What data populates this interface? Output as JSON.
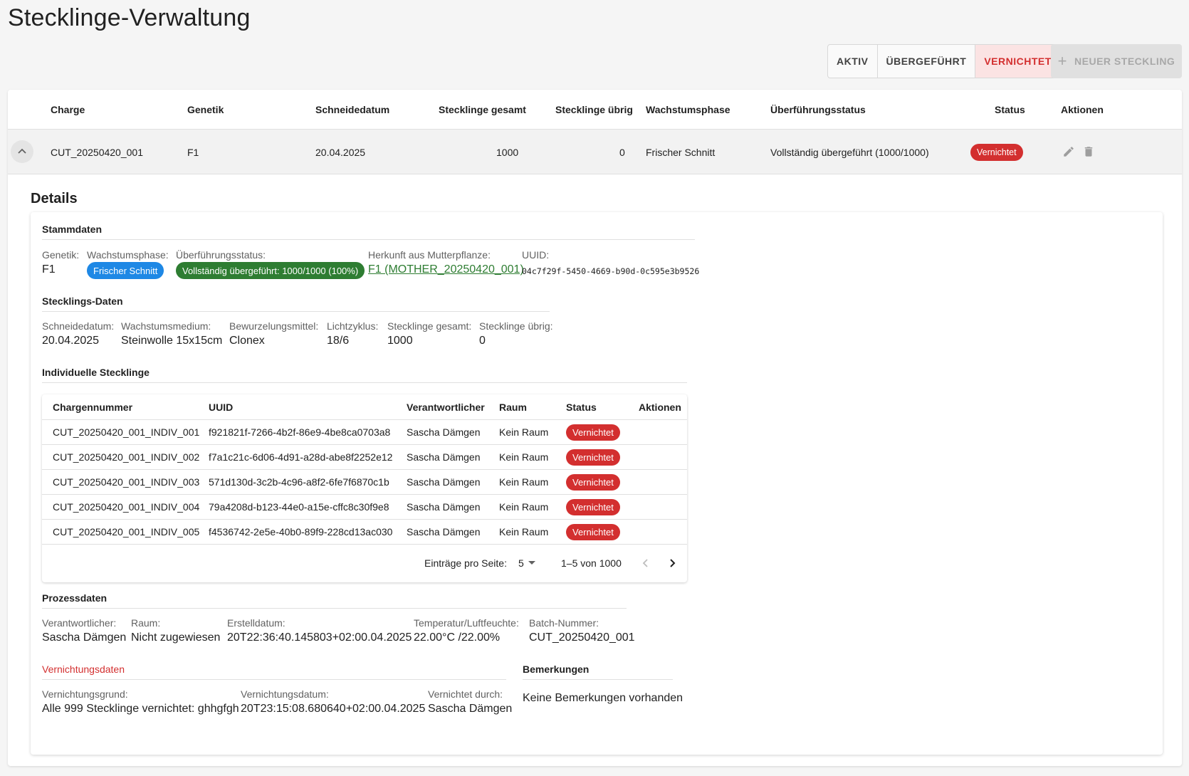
{
  "page": {
    "title": "Stecklinge-Verwaltung"
  },
  "filters": [
    {
      "label": "AKTIV",
      "active": false
    },
    {
      "label": "ÜBERGEFÜHRT",
      "active": false
    },
    {
      "label": "VERNICHTET",
      "active": true
    }
  ],
  "new_button": {
    "label": "NEUER STECKLING",
    "disabled": true
  },
  "table": {
    "headers": [
      "Charge",
      "Genetik",
      "Schneidedatum",
      "Stecklinge gesamt",
      "Stecklinge übrig",
      "Wachstumsphase",
      "Überführungsstatus",
      "Status",
      "Aktionen"
    ],
    "row": {
      "charge": "CUT_20250420_001",
      "genetik": "F1",
      "schneidedatum": "20.04.2025",
      "gesamt": "1000",
      "uebrig": "0",
      "phase": "Frischer Schnitt",
      "ueberfuehrung": "Vollständig übergeführt (1000/1000)",
      "status": "Vernichtet"
    }
  },
  "details": {
    "title": "Details",
    "stammdaten": {
      "title": "Stammdaten",
      "genetik_label": "Genetik:",
      "genetik": "F1",
      "phase_label": "Wachstumsphase:",
      "phase": "Frischer Schnitt",
      "ueber_label": "Überführungsstatus:",
      "ueber": "Vollständig übergeführt: 1000/1000 (100%)",
      "herkunft_label": "Herkunft aus Mutterpflanze:",
      "herkunft": "F1 (MOTHER_20250420_001)",
      "uuid_label": "UUID:",
      "uuid": "04c7f29f-5450-4669-b90d-0c595e3b9526"
    },
    "stecklings": {
      "title": "Stecklings-Daten",
      "schneidedatum_label": "Schneidedatum:",
      "schneidedatum": "20.04.2025",
      "medium_label": "Wachstumsmedium:",
      "medium": "Steinwolle 15x15cm",
      "bewurz_label": "Bewurzelungsmittel:",
      "bewurz": "Clonex",
      "licht_label": "Lichtzyklus:",
      "licht": "18/6",
      "gesamt_label": "Stecklinge gesamt:",
      "gesamt": "1000",
      "uebrig_label": "Stecklinge übrig:",
      "uebrig": "0"
    },
    "individuelle": {
      "title": "Individuelle Stecklinge",
      "headers": [
        "Chargennummer",
        "UUID",
        "Verantwortlicher",
        "Raum",
        "Status",
        "Aktionen"
      ],
      "rows": [
        {
          "charge": "CUT_20250420_001_INDIV_001",
          "uuid": "f921821f-7266-4b2f-86e9-4be8ca0703a8",
          "person": "Sascha Dämgen",
          "raum": "Kein Raum",
          "status": "Vernichtet"
        },
        {
          "charge": "CUT_20250420_001_INDIV_002",
          "uuid": "f7a1c21c-6d06-4d91-a28d-abe8f2252e12",
          "person": "Sascha Dämgen",
          "raum": "Kein Raum",
          "status": "Vernichtet"
        },
        {
          "charge": "CUT_20250420_001_INDIV_003",
          "uuid": "571d130d-3c2b-4c96-a8f2-6fe7f6870c1b",
          "person": "Sascha Dämgen",
          "raum": "Kein Raum",
          "status": "Vernichtet"
        },
        {
          "charge": "CUT_20250420_001_INDIV_004",
          "uuid": "79a4208d-b123-44e0-a15e-cffc8c30f9e8",
          "person": "Sascha Dämgen",
          "raum": "Kein Raum",
          "status": "Vernichtet"
        },
        {
          "charge": "CUT_20250420_001_INDIV_005",
          "uuid": "f4536742-2e5e-40b0-89f9-228cd13ac030",
          "person": "Sascha Dämgen",
          "raum": "Kein Raum",
          "status": "Vernichtet"
        }
      ],
      "pager": {
        "per_page_label": "Einträge pro Seite:",
        "per_page": "5",
        "range": "1–5 von 1000"
      }
    },
    "prozess": {
      "title": "Prozessdaten",
      "verant_label": "Verantwortlicher:",
      "verant": "Sascha Dämgen",
      "raum_label": "Raum:",
      "raum": "Nicht zugewiesen",
      "erstell_label": "Erstelldatum:",
      "erstell": "20T22:36:40.145803+02:00.04.2025",
      "temp_label": "Temperatur/Luftfeuchte:",
      "temp": "22.00°C /22.00%",
      "batch_label": "Batch-Nummer:",
      "batch": "CUT_20250420_001"
    },
    "vernichtung": {
      "title": "Vernichtungsdaten",
      "grund_label": "Vernichtungsgrund:",
      "grund": "Alle 999 Stecklinge vernichtet: ghhgfgh",
      "datum_label": "Vernichtungsdatum:",
      "datum": "20T23:15:08.680640+02:00.04.2025",
      "durch_label": "Vernichtet durch:",
      "durch": "Sascha Dämgen"
    },
    "bemerkungen": {
      "title": "Bemerkungen",
      "text": "Keine Bemerkungen vorhanden"
    }
  },
  "colors": {
    "danger": "#d32f2f",
    "primary": "#1e88e5",
    "success": "#2e7d32"
  }
}
